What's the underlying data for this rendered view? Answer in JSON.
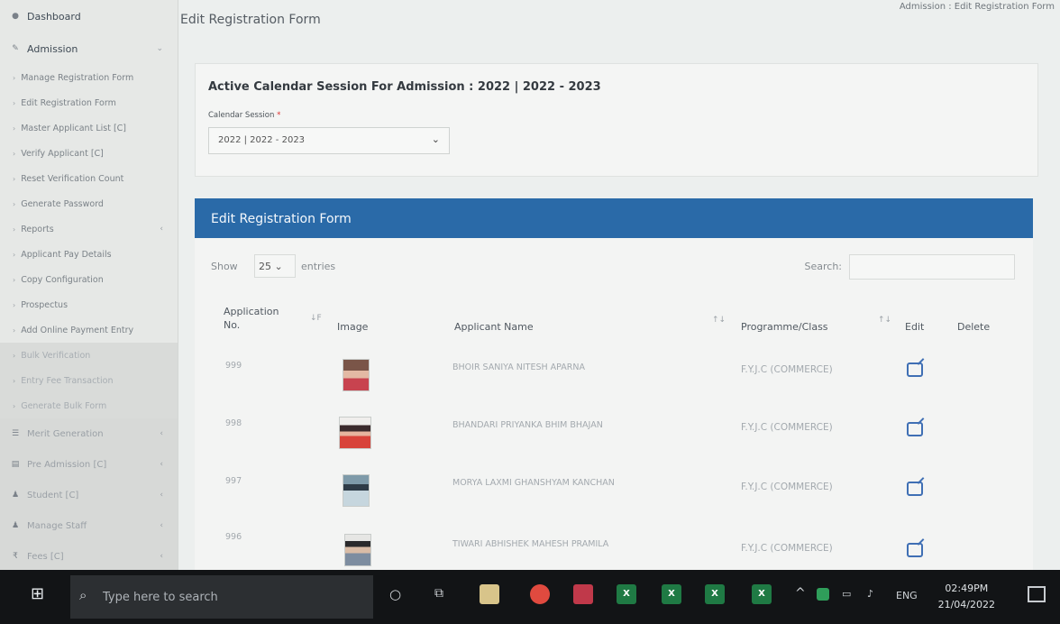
{
  "breadcrumb": "Admission : Edit Registration Form",
  "page_title": "Edit Registration Form",
  "sidebar": {
    "top_items": [
      {
        "label": "Dashboard",
        "icon": "dashboard-icon"
      },
      {
        "label": "Admission",
        "icon": "edit-icon"
      }
    ],
    "sub_items": [
      "Manage Registration Form",
      "Edit Registration Form",
      "Master Applicant List [C]",
      "Verify Applicant [C]",
      "Reset Verification Count",
      "Generate Password",
      "Reports",
      "Applicant Pay Details",
      "Copy Configuration",
      "Prospectus",
      "Add Online Payment Entry"
    ],
    "dim_items": [
      "Bulk Verification",
      "Entry Fee Transaction",
      "Generate Bulk Form"
    ],
    "menu_items": [
      "Merit Generation",
      "Pre Admission [C]",
      "Student [C]",
      "Manage Staff",
      "Fees [C]"
    ]
  },
  "session": {
    "title": "Active Calendar Session For Admission : 2022 | 2022 - 2023",
    "label": "Calendar Session",
    "required_mark": "*",
    "selected": "2022 | 2022 - 2023"
  },
  "table": {
    "header": "Edit Registration Form",
    "show_label": "Show",
    "entries_value": "25",
    "entries_label": "entries",
    "search_label": "Search:",
    "columns": {
      "app_no_line1": "Application",
      "app_no_line2": "No.",
      "image": "Image",
      "name": "Applicant Name",
      "programme": "Programme/Class",
      "edit": "Edit",
      "delete": "Delete"
    },
    "rows": [
      {
        "app_no": "999",
        "name": "BHOIR SANIYA NITESH APARNA",
        "programme": "F.Y.J.C (COMMERCE)"
      },
      {
        "app_no": "998",
        "name": "BHANDARI PRIYANKA BHIM BHAJAN",
        "programme": "F.Y.J.C (COMMERCE)"
      },
      {
        "app_no": "997",
        "name": "MORYA LAXMI GHANSHYAM KANCHAN",
        "programme": "F.Y.J.C (COMMERCE)"
      },
      {
        "app_no": "996",
        "name": "TIWARI ABHISHEK MAHESH PRAMILA",
        "programme": "F.Y.J.C (COMMERCE)"
      }
    ]
  },
  "taskbar": {
    "search_placeholder": "Type here to search",
    "language": "ENG",
    "time": "02:49PM",
    "date": "21/04/2022"
  },
  "colors": {
    "header_blue": "#2a6aa8",
    "edit_icon": "#3f6fb4"
  }
}
